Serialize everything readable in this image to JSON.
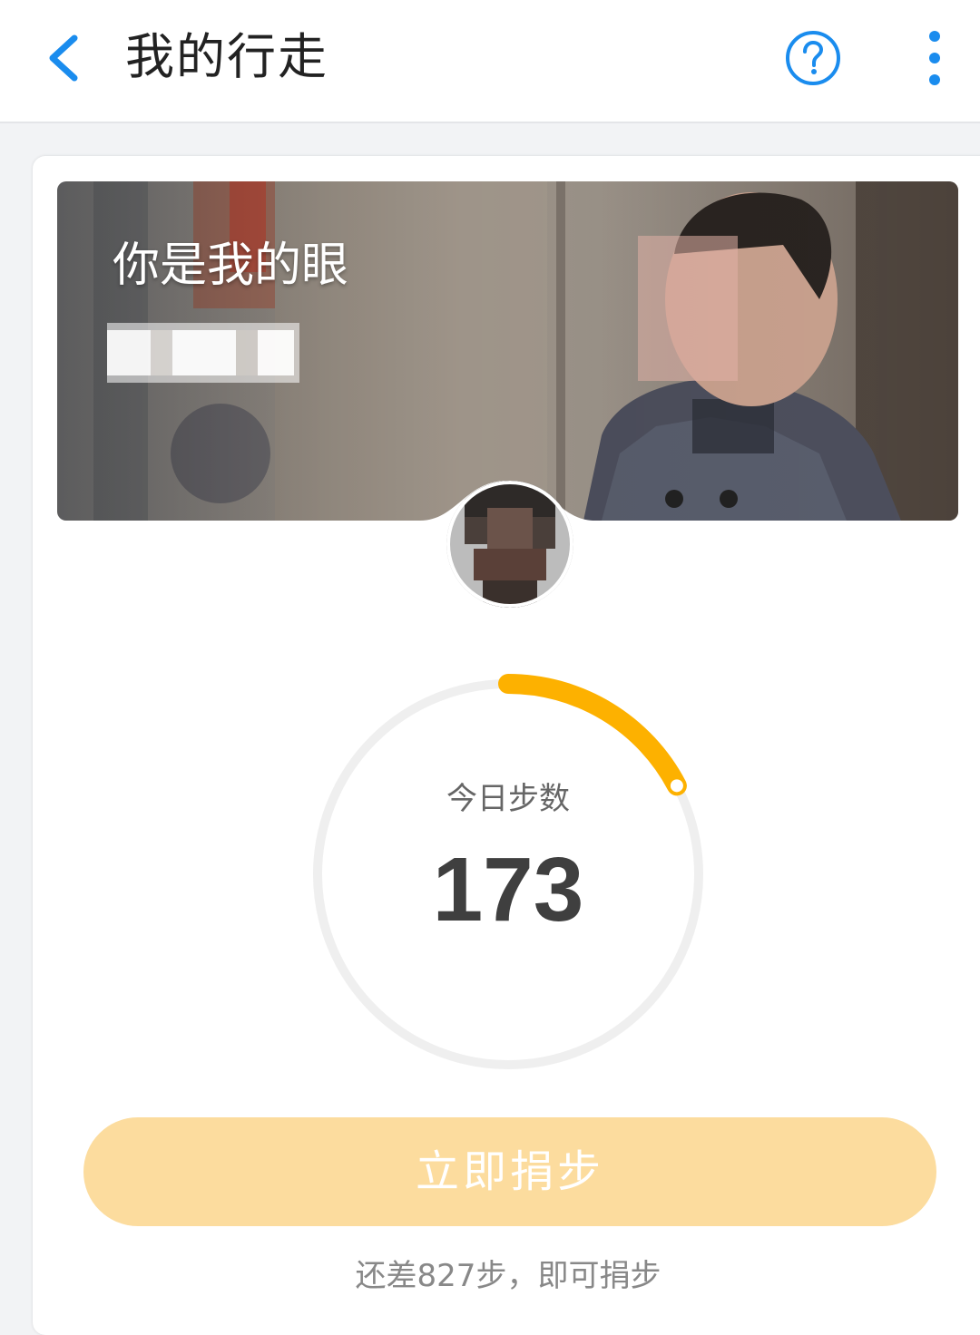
{
  "header": {
    "title": "我的行走",
    "back_icon": "chevron-left-icon",
    "help_icon": "question-circle-icon",
    "more_icon": "vertical-ellipsis-icon",
    "accent_color": "#1a8cee"
  },
  "project": {
    "title": "你是我的眼"
  },
  "steps": {
    "label": "今日步数",
    "value": "173",
    "progress_fraction": 0.173,
    "progress_color": "#fdb100"
  },
  "donate_button": {
    "label": "立即捐步",
    "color": "#fcdc9e"
  },
  "hint": {
    "text": "还差827步，即可捐步"
  }
}
